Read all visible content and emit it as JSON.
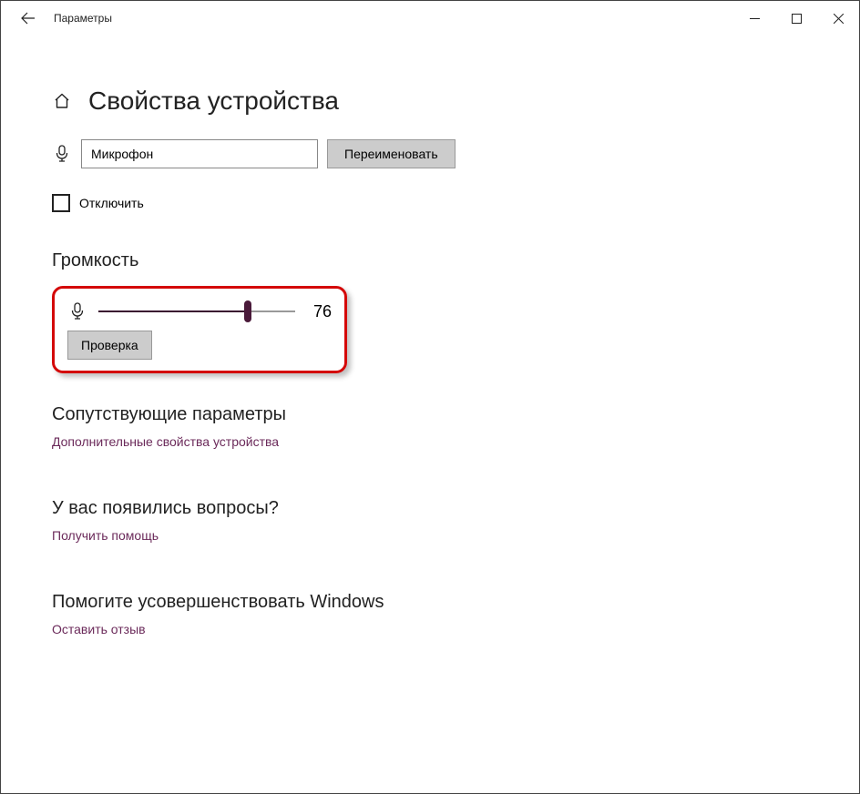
{
  "window": {
    "title": "Параметры"
  },
  "page": {
    "heading": "Свойства устройства",
    "device_name": "Микрофон",
    "rename_btn": "Переименовать",
    "disable_label": "Отключить",
    "volume_heading": "Громкость",
    "volume_value": "76",
    "volume_percent": 76,
    "test_btn": "Проверка"
  },
  "sections": {
    "related": {
      "title": "Сопутствующие параметры",
      "link": "Дополнительные свойства устройства"
    },
    "help": {
      "title": "У вас появились вопросы?",
      "link": "Получить помощь"
    },
    "feedback": {
      "title": "Помогите усовершенствовать Windows",
      "link": "Оставить отзыв"
    }
  }
}
